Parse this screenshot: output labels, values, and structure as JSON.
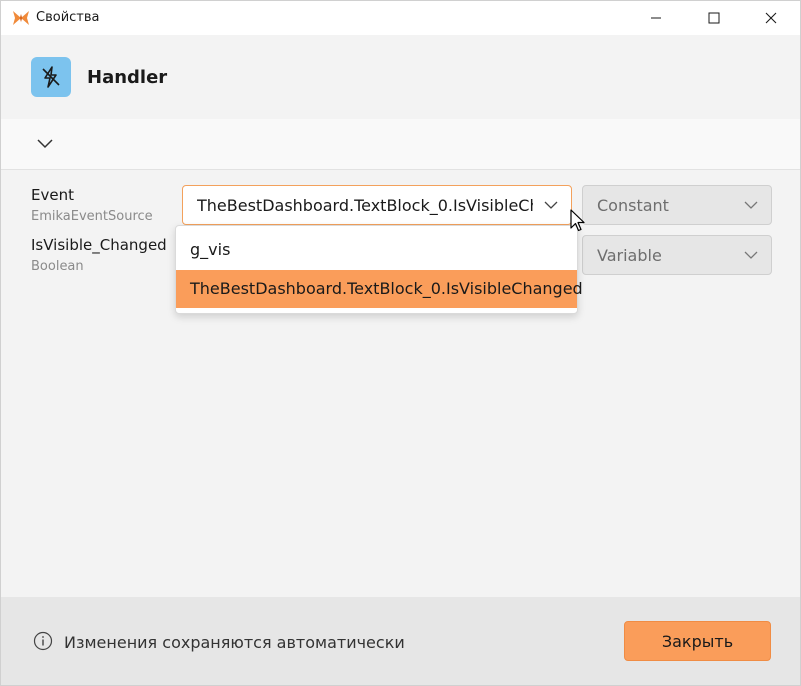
{
  "window": {
    "title": "Свойства",
    "accent_color": "#fa9d5a"
  },
  "header": {
    "title": "Handler",
    "icon": "handler-lightning-icon"
  },
  "properties": [
    {
      "label": "Event",
      "type": "EmikaEventSource",
      "value": "TheBestDashboard.TextBlock_0.IsVisibleChanged",
      "mode": "Constant"
    },
    {
      "label": "IsVisible_Changed",
      "type": "Boolean",
      "mode": "Variable"
    }
  ],
  "dropdown": {
    "items": [
      {
        "label": "g_vis",
        "selected": false
      },
      {
        "label": "TheBestDashboard.TextBlock_0.IsVisibleChanged",
        "selected": true
      }
    ]
  },
  "footer": {
    "info_text": "Изменения сохраняются автоматически",
    "close_label": "Закрыть"
  }
}
